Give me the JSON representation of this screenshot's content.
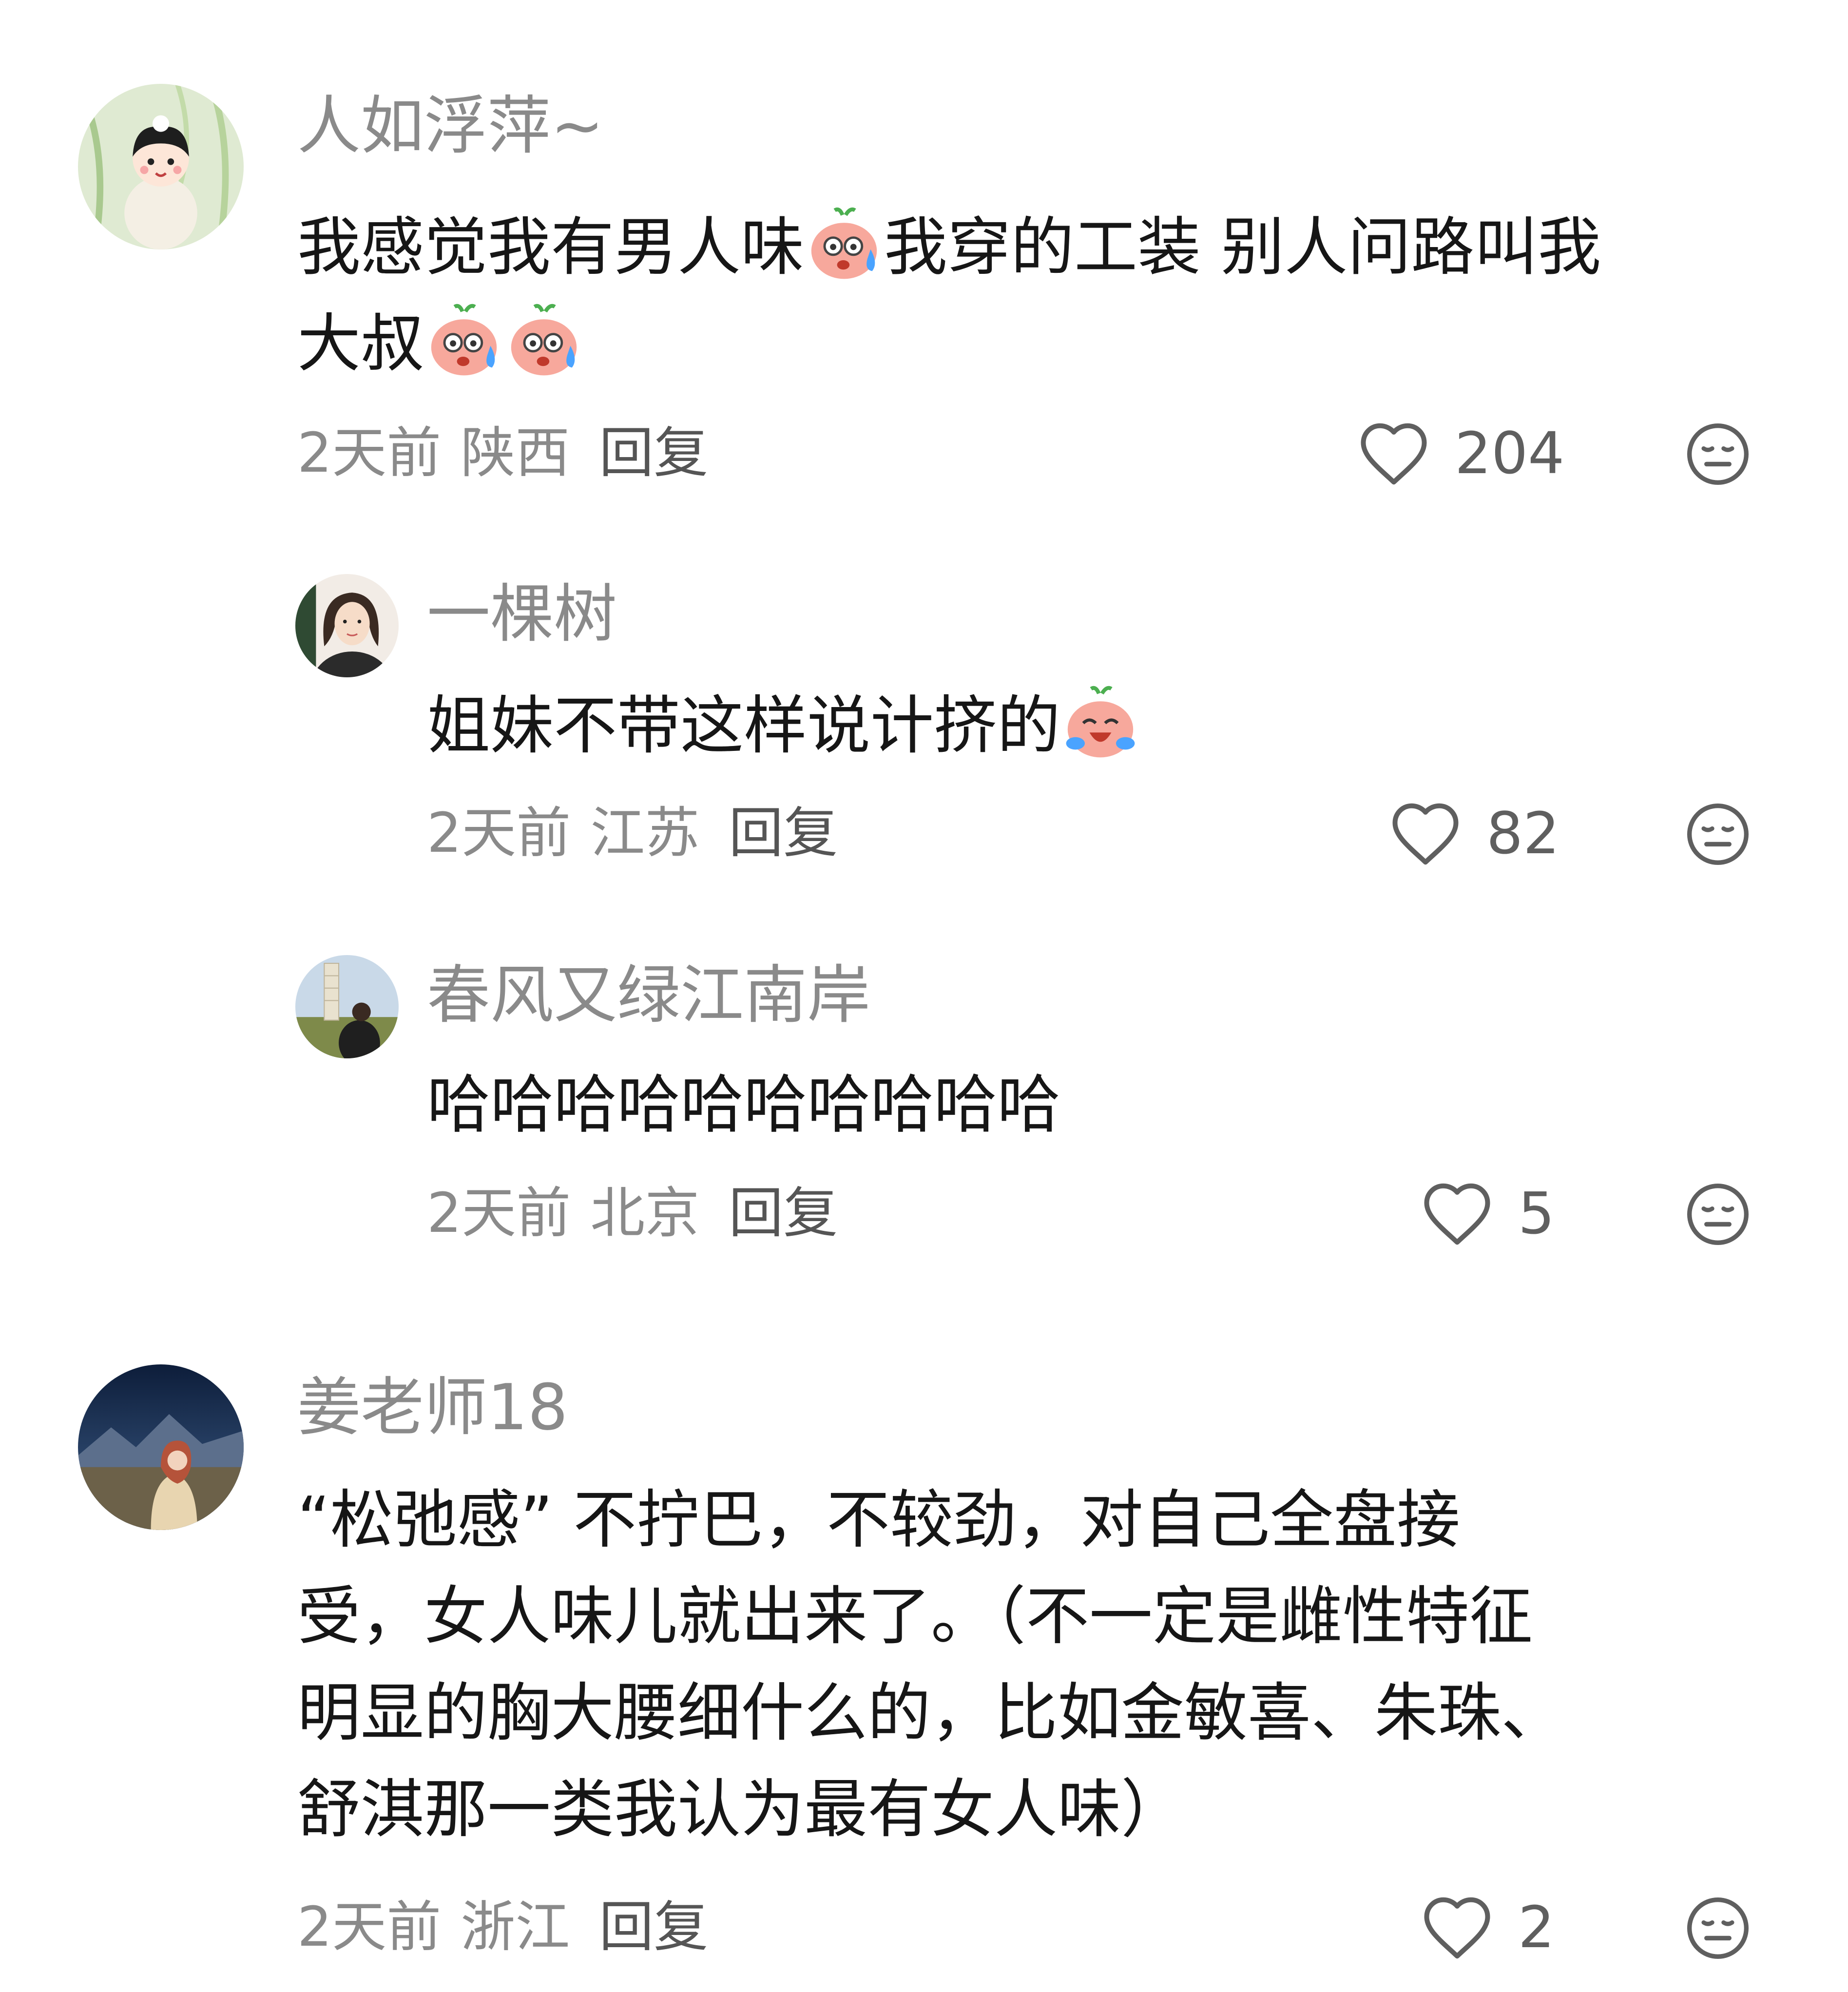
{
  "comments": [
    {
      "username": "人如浮萍~",
      "content_lines": [
        "我感觉我有男人味",
        "我穿的工装 别人问路叫我",
        "大叔"
      ],
      "time": "2天前",
      "location": "陕西",
      "reply_label": "回复",
      "likes": "204",
      "emoji": "sweat-face-emoji",
      "replies": [
        {
          "username": "一棵树",
          "content": "姐妹不带这样说计挤的",
          "time": "2天前",
          "location": "江苏",
          "reply_label": "回复",
          "likes": "82",
          "emoji": "crying-laughing-emoji"
        },
        {
          "username": "春风又绿江南岸",
          "content": "哈哈哈哈哈哈哈哈哈哈",
          "time": "2天前",
          "location": "北京",
          "reply_label": "回复",
          "likes": "5"
        }
      ]
    },
    {
      "username": "姜老师18",
      "content_lines": [
        "“松弛感” 不拧巴，不较劲，对自己全盘接",
        "受，女人味儿就出来了。（不一定是雌性特征",
        "明显的胸大腰细什么的，比如金敏喜、朱珠、",
        "舒淇那一类我认为最有女人味）"
      ],
      "time": "2天前",
      "location": "浙江",
      "reply_label": "回复",
      "likes": "2"
    }
  ],
  "icons": {
    "like": "heart-outline-icon",
    "dislike": "neutral-face-icon"
  },
  "colors": {
    "username": "#8a8a8a",
    "content": "#161616",
    "meta": "#8a8a8a",
    "reply": "#555555",
    "icon": "#5f5f5f"
  }
}
